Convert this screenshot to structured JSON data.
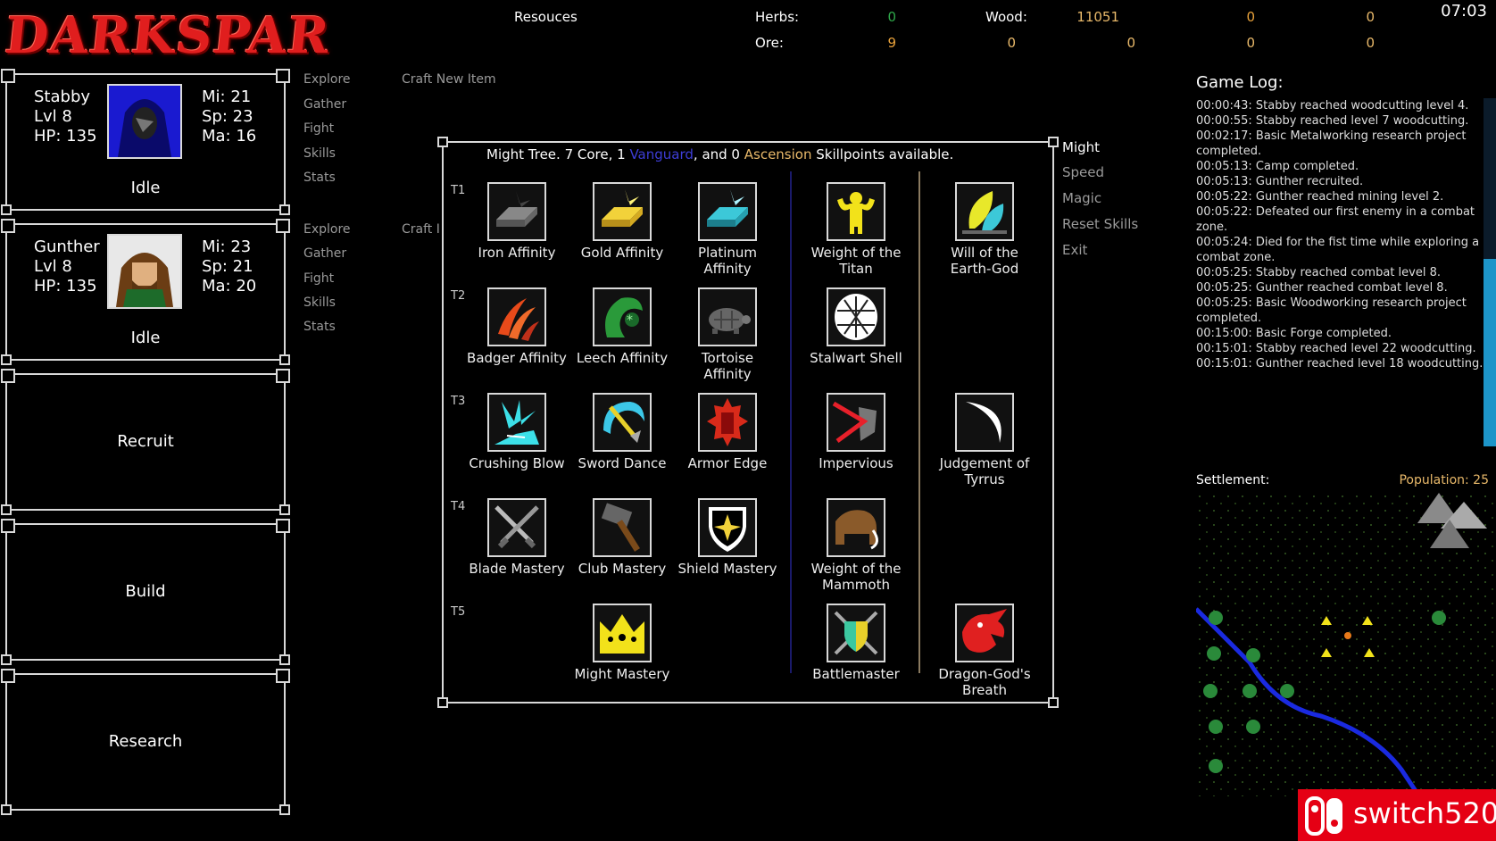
{
  "logo": "DARKSPAR",
  "clock": "07:03",
  "resources": {
    "title": "Resouces",
    "herbs_label": "Herbs:",
    "herbs_value": "0",
    "wood_label": "Wood:",
    "wood_value": "11051",
    "r1c5": "0",
    "r1c6": "0",
    "ore_label": "Ore:",
    "ore_value": "9",
    "r2c3": "0",
    "r2c4": "0",
    "r2c5": "0",
    "r2c6": "0"
  },
  "heroes": [
    {
      "name": "Stabby",
      "lvl": "Lvl 8",
      "hp": "HP: 135",
      "mi": "Mi: 21",
      "sp": "Sp: 23",
      "ma": "Ma: 16",
      "status": "Idle"
    },
    {
      "name": "Gunther",
      "lvl": "Lvl 8",
      "hp": "HP: 135",
      "mi": "Mi: 23",
      "sp": "Sp: 21",
      "ma": "Ma: 20",
      "status": "Idle"
    }
  ],
  "menu": {
    "explore": "Explore",
    "gather": "Gather",
    "fight": "Fight",
    "skills": "Skills",
    "stats": "Stats",
    "craft_new": "Craft New Item",
    "craft_cut": "Craft I"
  },
  "actions": {
    "recruit": "Recruit",
    "build": "Build",
    "research": "Research"
  },
  "panel": {
    "t_a": "Might Tree. 7 Core, 1 ",
    "t_vanguard": "Vanguard",
    "t_b": ", and 0 ",
    "t_ascension": "Ascension",
    "t_c": " Skillpoints available.",
    "tiers": [
      "T1",
      "T2",
      "T3",
      "T4",
      "T5"
    ],
    "skills": {
      "iron": "Iron Affinity",
      "gold": "Gold Affinity",
      "platinum": "Platinum Affinity",
      "titan": "Weight of the Titan",
      "earthgod": "Will of the Earth-God",
      "badger": "Badger Affinity",
      "leech": "Leech Affinity",
      "tortoise": "Tortoise Affinity",
      "stalwart": "Stalwart Shell",
      "crushing": "Crushing Blow",
      "sword": "Sword Dance",
      "armor": "Armor Edge",
      "impervious": "Impervious",
      "tyrrus": "Judgement of Tyrrus",
      "blade": "Blade Mastery",
      "club": "Club Mastery",
      "shield": "Shield Mastery",
      "mammoth": "Weight of the Mammoth",
      "might": "Might Mastery",
      "battlemaster": "Battlemaster",
      "dragon": "Dragon-God's Breath"
    }
  },
  "side": {
    "might": "Might",
    "speed": "Speed",
    "magic": "Magic",
    "reset": "Reset Skills",
    "exit": "Exit"
  },
  "log": {
    "title": "Game Log:",
    "entries": [
      "00:00:43: Stabby reached woodcutting level 4.",
      "00:00:55: Stabby reached level 7 woodcutting.",
      "00:02:17: Basic Metalworking research project completed.",
      "00:05:13: Camp completed.",
      "00:05:13: Gunther recruited.",
      "00:05:22: Gunther reached mining level 2.",
      "00:05:22: Defeated our first enemy in a combat zone.",
      "00:05:24: Died for the fist time while exploring a combat zone.",
      "00:05:25: Stabby reached combat level 8.",
      "00:05:25: Gunther reached combat level 8.",
      "00:05:25: Basic Woodworking research project completed.",
      "00:15:00: Basic Forge completed.",
      "00:15:01: Stabby reached level 22 woodcutting.",
      "00:15:01: Gunther reached level 18 woodcutting."
    ]
  },
  "settlement": {
    "label": "Settlement:",
    "population": "Population: 25"
  },
  "watermark": "switch520",
  "colors": {
    "accent_red": "#e01e1e",
    "vanguard": "#3d3dd6",
    "ascension": "#e9b96a",
    "scroll": "#1d95c9"
  }
}
